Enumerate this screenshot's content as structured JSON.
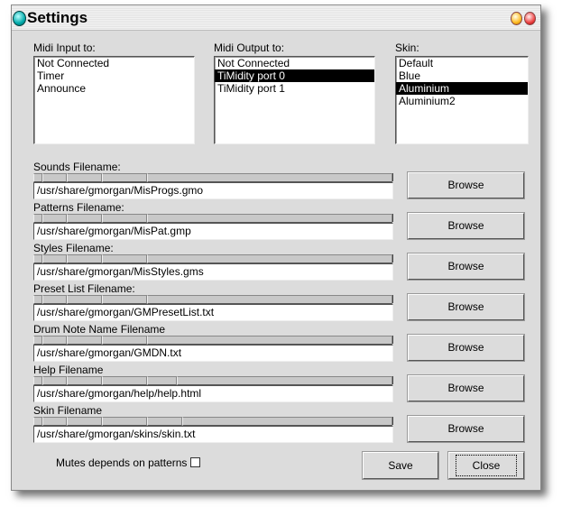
{
  "window": {
    "title": "Settings"
  },
  "midi_input": {
    "label": "Midi Input to:",
    "items": [
      "Not Connected",
      "Timer",
      "Announce"
    ],
    "selected": -1
  },
  "midi_output": {
    "label": "Midi Output to:",
    "items": [
      "Not Connected",
      "TiMidity port 0",
      "TiMidity port 1"
    ],
    "selected": 1
  },
  "skin": {
    "label": "Skin:",
    "items": [
      "Default",
      "Blue",
      "Aluminium",
      "Aluminium2"
    ],
    "selected": 2
  },
  "files": [
    {
      "label": "Sounds Filename:",
      "value": "/usr/share/gmorgan/MisProgs.gmo",
      "browse": "Browse"
    },
    {
      "label": "Patterns Filename:",
      "value": "/usr/share/gmorgan/MisPat.gmp",
      "browse": "Browse"
    },
    {
      "label": "Styles Filename:",
      "value": "/usr/share/gmorgan/MisStyles.gms",
      "browse": "Browse"
    },
    {
      "label": "Preset List Filename:",
      "value": "/usr/share/gmorgan/GMPresetList.txt",
      "browse": "Browse"
    },
    {
      "label": "Drum Note Name Filename",
      "value": "/usr/share/gmorgan/GMDN.txt",
      "browse": "Browse"
    },
    {
      "label": "Help Filename",
      "value": "/usr/share/gmorgan/help/help.html",
      "browse": "Browse"
    },
    {
      "label": "Skin Filename",
      "value": "/usr/share/gmorgan/skins/skin.txt",
      "browse": "Browse"
    }
  ],
  "mutes": {
    "label": "Mutes depends on patterns",
    "checked": false
  },
  "buttons": {
    "save": "Save",
    "close": "Close"
  }
}
